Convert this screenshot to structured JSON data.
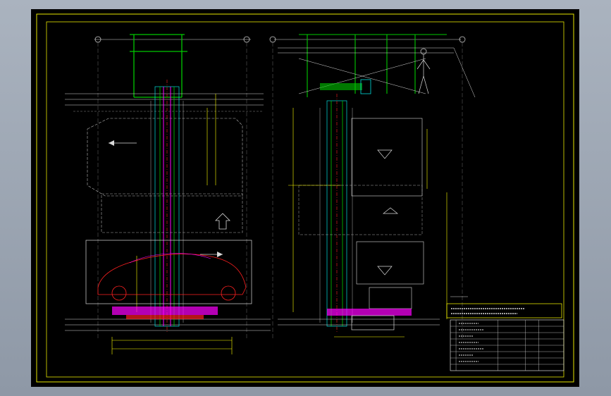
{
  "colors": {
    "frame": "#e6e600",
    "structure_white": "#d9d9d9",
    "guide_green": "#00c800",
    "mechanism_magenta": "#ff00ff",
    "mechanism_red": "#ff2020",
    "mechanism_cyan": "#00dede",
    "dimension_yellow": "#ffff00",
    "background": "#000000"
  },
  "title_block": {
    "rows": 8,
    "columns": 5
  }
}
